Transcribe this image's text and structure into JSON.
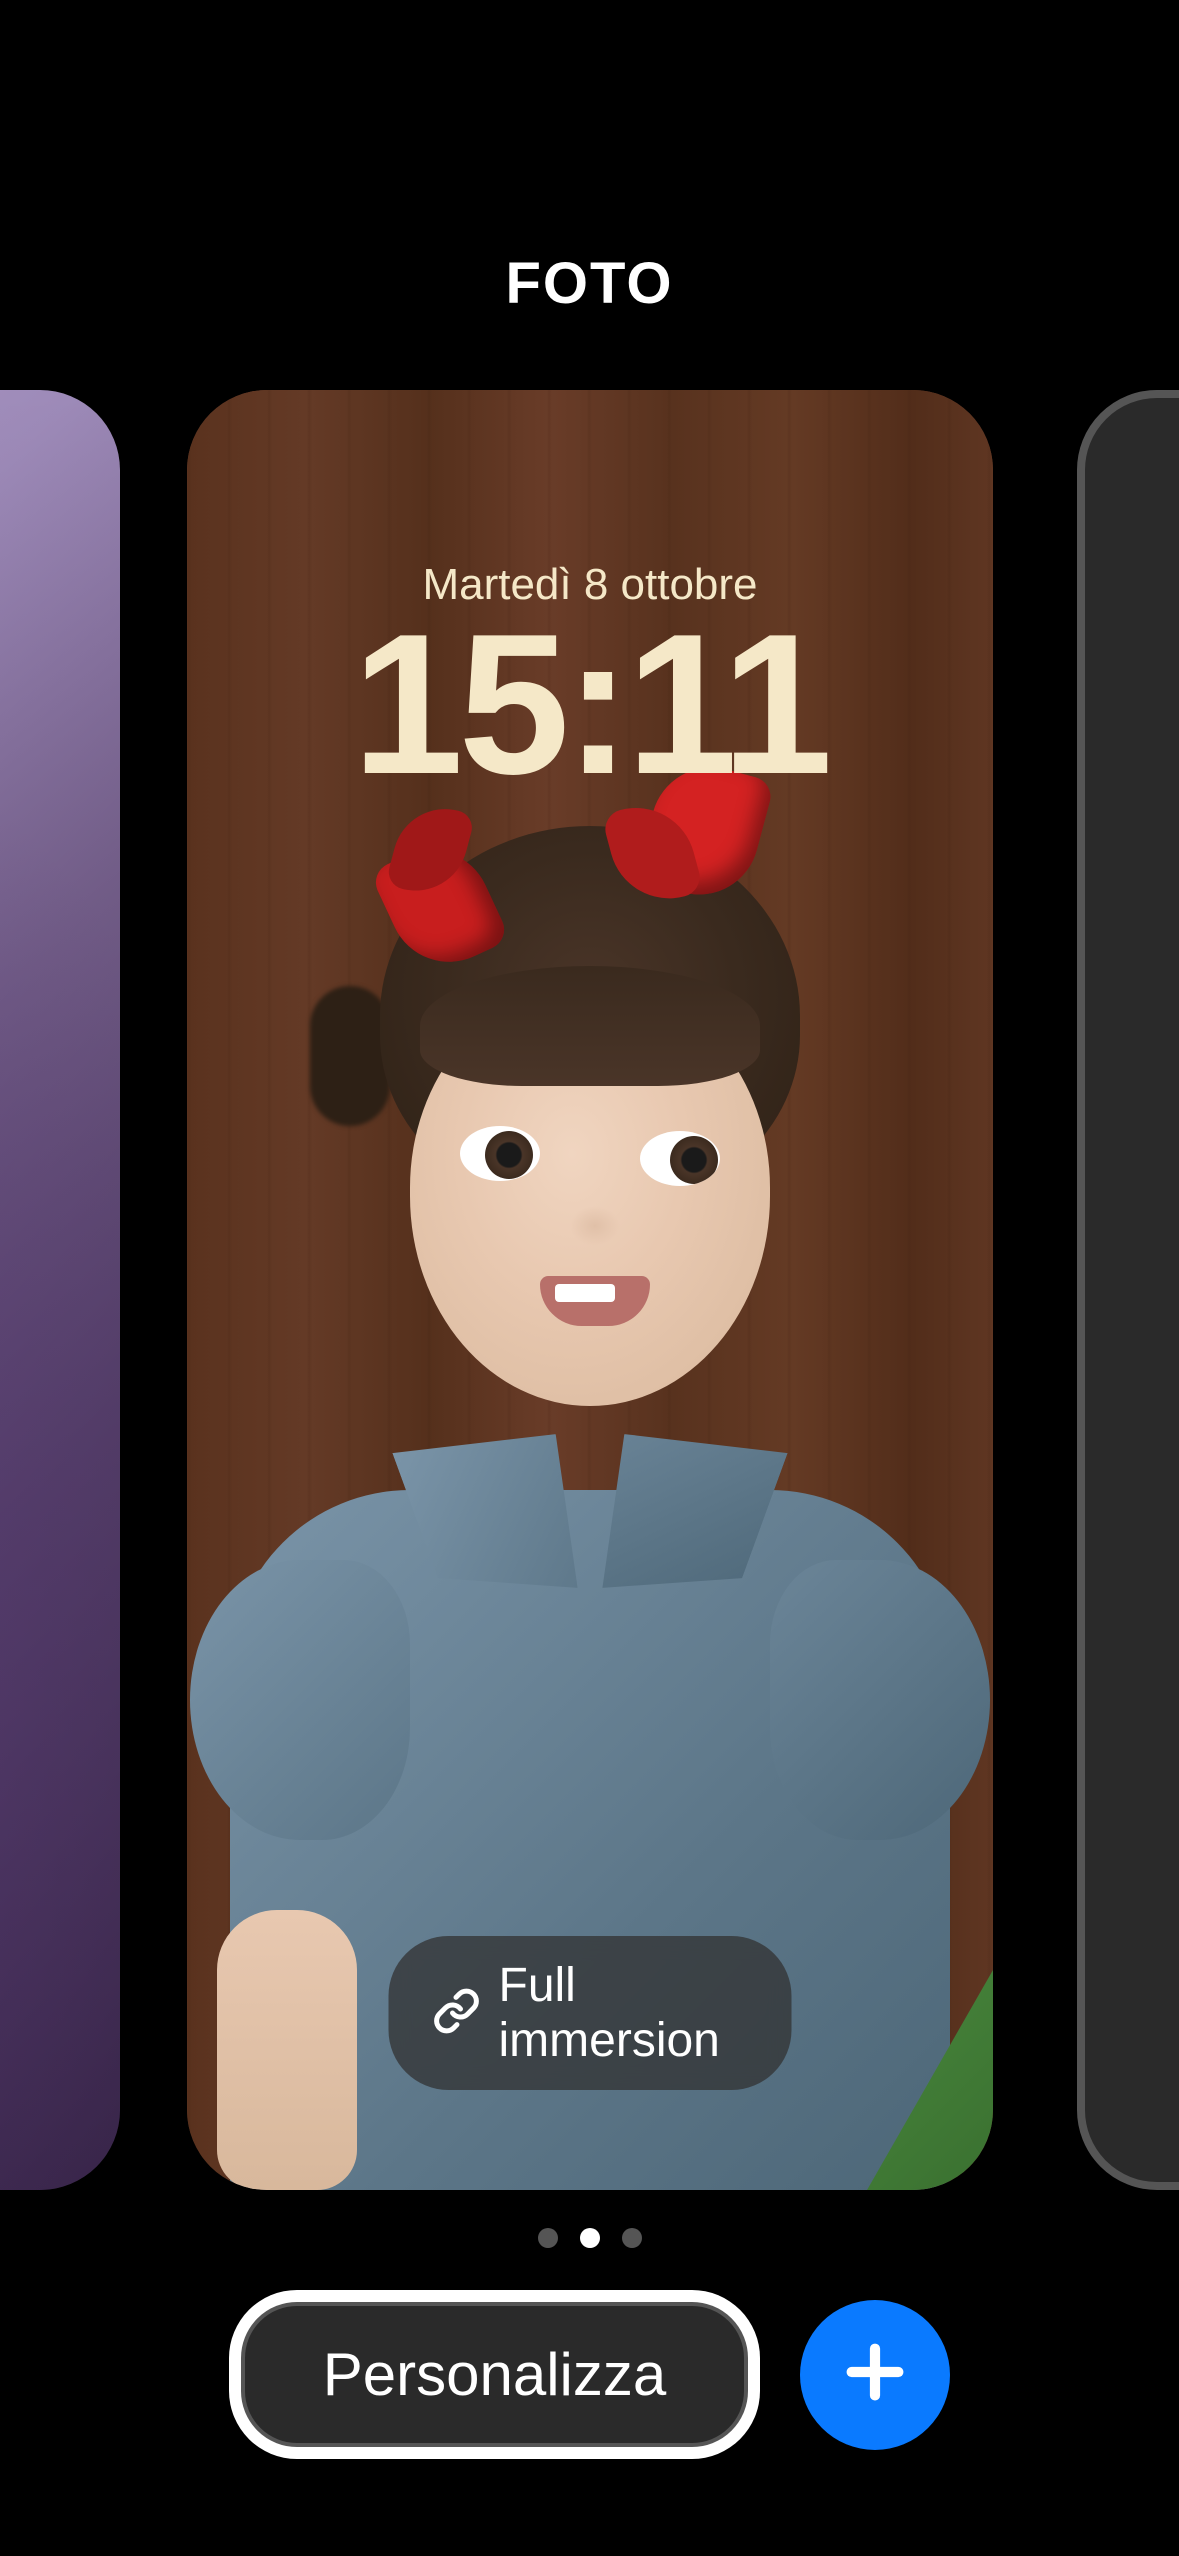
{
  "header": {
    "title": "FOTO"
  },
  "lockscreen": {
    "date": "Martedì 8 ottobre",
    "time": "15:11",
    "focus_label": "Full immersion"
  },
  "pagination": {
    "total": 3,
    "active_index": 1
  },
  "actions": {
    "customize_label": "Personalizza"
  },
  "icons": {
    "link": "link-icon",
    "plus": "plus-icon"
  },
  "colors": {
    "accent": "#0a7aff",
    "time_text": "#f5e8c8"
  }
}
